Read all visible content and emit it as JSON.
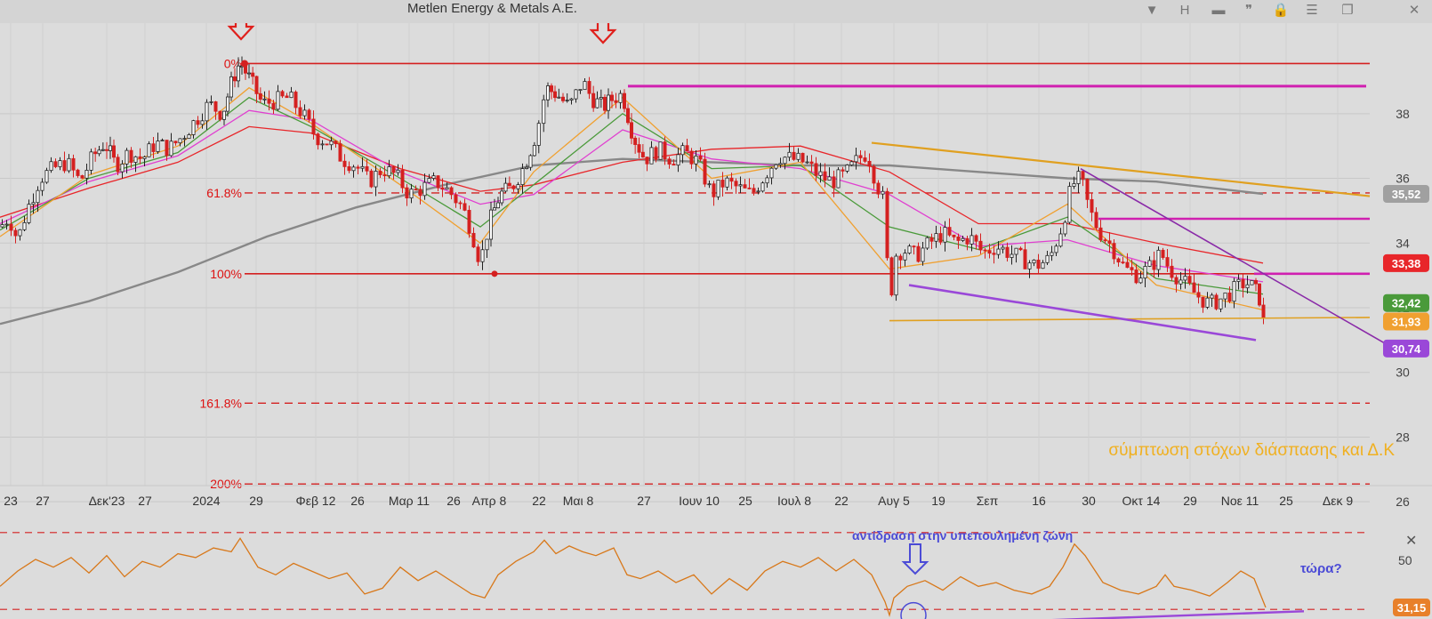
{
  "app": {
    "title": "Metlen Energy & Metals A.E.",
    "toolbar": [
      {
        "name": "dropdown-icon",
        "glyph": "▼"
      },
      {
        "name": "interval-button",
        "glyph": "H"
      },
      {
        "name": "layout-icon",
        "glyph": "▬"
      },
      {
        "name": "comment-icon",
        "glyph": "❞"
      },
      {
        "name": "lock-icon",
        "glyph": "🔒"
      },
      {
        "name": "menu-icon",
        "glyph": "☰"
      },
      {
        "name": "window-icon",
        "glyph": "❐"
      },
      {
        "name": "close-icon",
        "glyph": "✕"
      }
    ]
  },
  "chart_data": [
    {
      "type": "candlestick",
      "title": "Metlen Energy & Metals A.E.",
      "interval": "H",
      "ylim": [
        25.4,
        40.8
      ],
      "yticks": [
        26,
        28,
        30,
        32,
        34,
        36,
        38
      ],
      "xticks": [
        "23",
        "27",
        "Δεκ'23",
        "27",
        "2024",
        "29",
        "Φεβ 12",
        "26",
        "Μαρ 11",
        "26",
        "Απρ 8",
        "22",
        "Μαι 8",
        "27",
        "Ιουν 10",
        "25",
        "Ιουλ 8",
        "22",
        "Αυγ 5",
        "19",
        "Σεπ",
        "16",
        "30",
        "Οκτ 14",
        "29",
        "Νοε 11",
        "25",
        "Δεκ 9"
      ],
      "close_path": [
        [
          0,
          34.5
        ],
        [
          10,
          34.8
        ],
        [
          20,
          34.1
        ],
        [
          30,
          35.0
        ],
        [
          45,
          36.0
        ],
        [
          60,
          36.3
        ],
        [
          75,
          36.5
        ],
        [
          90,
          35.9
        ],
        [
          105,
          36.7
        ],
        [
          118,
          37.1
        ],
        [
          130,
          36.4
        ],
        [
          145,
          36.8
        ],
        [
          160,
          36.6
        ],
        [
          175,
          37.1
        ],
        [
          190,
          36.9
        ],
        [
          205,
          37.3
        ],
        [
          220,
          37.8
        ],
        [
          235,
          38.3
        ],
        [
          250,
          38.0
        ],
        [
          262,
          39.1
        ],
        [
          270,
          39.6
        ],
        [
          282,
          39.0
        ],
        [
          295,
          38.3
        ],
        [
          310,
          38.4
        ],
        [
          325,
          38.5
        ],
        [
          340,
          38.0
        ],
        [
          355,
          37.3
        ],
        [
          370,
          37.1
        ],
        [
          385,
          36.6
        ],
        [
          400,
          36.4
        ],
        [
          415,
          35.9
        ],
        [
          430,
          36.3
        ],
        [
          445,
          36.1
        ],
        [
          460,
          35.5
        ],
        [
          475,
          35.7
        ],
        [
          490,
          35.9
        ],
        [
          505,
          35.6
        ],
        [
          520,
          35.1
        ],
        [
          530,
          34.4
        ],
        [
          540,
          33.4
        ],
        [
          550,
          34.6
        ],
        [
          562,
          35.5
        ],
        [
          575,
          35.7
        ],
        [
          590,
          36.4
        ],
        [
          603,
          37.4
        ],
        [
          614,
          38.8
        ],
        [
          626,
          38.6
        ],
        [
          640,
          38.2
        ],
        [
          655,
          39.0
        ],
        [
          665,
          38.5
        ],
        [
          678,
          38.2
        ],
        [
          690,
          38.5
        ],
        [
          700,
          38.6
        ],
        [
          712,
          37.3
        ],
        [
          725,
          36.6
        ],
        [
          740,
          36.9
        ],
        [
          755,
          36.6
        ],
        [
          770,
          36.8
        ],
        [
          785,
          36.5
        ],
        [
          800,
          35.5
        ],
        [
          815,
          35.9
        ],
        [
          830,
          35.7
        ],
        [
          845,
          35.5
        ],
        [
          860,
          36.1
        ],
        [
          875,
          36.7
        ],
        [
          890,
          36.6
        ],
        [
          905,
          36.5
        ],
        [
          920,
          36.1
        ],
        [
          935,
          35.9
        ],
        [
          950,
          36.1
        ],
        [
          965,
          36.6
        ],
        [
          975,
          36.8
        ],
        [
          985,
          35.9
        ],
        [
          995,
          35.2
        ],
        [
          1000,
          31.6
        ],
        [
          1005,
          33.6
        ],
        [
          1015,
          33.8
        ],
        [
          1030,
          33.6
        ],
        [
          1045,
          34.0
        ],
        [
          1060,
          34.3
        ],
        [
          1075,
          34.0
        ],
        [
          1090,
          34.2
        ],
        [
          1105,
          33.7
        ],
        [
          1120,
          33.9
        ],
        [
          1135,
          33.7
        ],
        [
          1150,
          33.5
        ],
        [
          1165,
          33.3
        ],
        [
          1180,
          33.5
        ],
        [
          1195,
          34.6
        ],
        [
          1205,
          35.8
        ],
        [
          1215,
          36.0
        ],
        [
          1225,
          35.0
        ],
        [
          1235,
          34.4
        ],
        [
          1250,
          33.9
        ],
        [
          1265,
          33.2
        ],
        [
          1280,
          33.0
        ],
        [
          1295,
          33.3
        ],
        [
          1305,
          33.7
        ],
        [
          1315,
          33.2
        ],
        [
          1330,
          32.8
        ],
        [
          1345,
          32.4
        ],
        [
          1360,
          32.1
        ],
        [
          1375,
          32.3
        ],
        [
          1390,
          32.6
        ],
        [
          1400,
          32.8
        ],
        [
          1410,
          32.6
        ],
        [
          1418,
          32.2
        ],
        [
          1423,
          30.9
        ]
      ],
      "series": [
        {
          "name": "",
          "color": "#888888",
          "values": [
            [
              0,
              31.5
            ],
            [
              100,
              32.2
            ],
            [
              200,
              33.1
            ],
            [
              300,
              34.2
            ],
            [
              400,
              35.1
            ],
            [
              500,
              35.8
            ],
            [
              600,
              36.4
            ],
            [
              700,
              36.6
            ],
            [
              800,
              36.5
            ],
            [
              900,
              36.4
            ],
            [
              1000,
              36.4
            ],
            [
              1100,
              36.2
            ],
            [
              1200,
              36.0
            ],
            [
              1300,
              35.9
            ],
            [
              1420,
              35.52
            ]
          ]
        },
        {
          "name": "",
          "color": "#e8262a",
          "values": [
            [
              0,
              34.8
            ],
            [
              100,
              35.7
            ],
            [
              200,
              36.5
            ],
            [
              280,
              37.6
            ],
            [
              350,
              37.4
            ],
            [
              450,
              36.3
            ],
            [
              540,
              35.6
            ],
            [
              600,
              35.8
            ],
            [
              700,
              36.5
            ],
            [
              800,
              36.9
            ],
            [
              900,
              37.0
            ],
            [
              1000,
              36.2
            ],
            [
              1100,
              34.6
            ],
            [
              1200,
              34.6
            ],
            [
              1300,
              34.0
            ],
            [
              1420,
              33.38
            ]
          ]
        },
        {
          "name": "",
          "color": "#e040d0",
          "values": [
            [
              0,
              34.6
            ],
            [
              100,
              35.9
            ],
            [
              200,
              36.7
            ],
            [
              280,
              38.1
            ],
            [
              350,
              37.8
            ],
            [
              450,
              36.2
            ],
            [
              540,
              35.2
            ],
            [
              600,
              35.5
            ],
            [
              700,
              37.5
            ],
            [
              800,
              36.6
            ],
            [
              900,
              36.3
            ],
            [
              1000,
              35.5
            ],
            [
              1100,
              33.9
            ],
            [
              1200,
              34.1
            ],
            [
              1300,
              33.3
            ],
            [
              1420,
              32.8
            ]
          ]
        },
        {
          "name": "",
          "color": "#4a9a3a",
          "values": [
            [
              0,
              34.4
            ],
            [
              100,
              36.0
            ],
            [
              200,
              36.8
            ],
            [
              280,
              38.5
            ],
            [
              350,
              37.6
            ],
            [
              450,
              36.0
            ],
            [
              540,
              34.5
            ],
            [
              600,
              35.8
            ],
            [
              700,
              38.0
            ],
            [
              800,
              36.3
            ],
            [
              900,
              36.4
            ],
            [
              1000,
              34.5
            ],
            [
              1100,
              33.8
            ],
            [
              1200,
              34.8
            ],
            [
              1300,
              32.9
            ],
            [
              1420,
              32.42
            ]
          ]
        },
        {
          "name": "",
          "color": "#f0a030",
          "values": [
            [
              0,
              34.2
            ],
            [
              100,
              36.1
            ],
            [
              200,
              37.0
            ],
            [
              280,
              38.8
            ],
            [
              350,
              37.7
            ],
            [
              450,
              35.8
            ],
            [
              540,
              34.0
            ],
            [
              600,
              36.2
            ],
            [
              700,
              38.5
            ],
            [
              800,
              36.0
            ],
            [
              900,
              36.5
            ],
            [
              1000,
              33.2
            ],
            [
              1100,
              33.6
            ],
            [
              1200,
              35.2
            ],
            [
              1300,
              32.7
            ],
            [
              1420,
              31.93
            ]
          ]
        }
      ],
      "fibonacci": [
        {
          "label": "0%",
          "value": 39.55
        },
        {
          "label": "61.8%",
          "value": 35.55
        },
        {
          "label": "100%",
          "value": 33.05
        },
        {
          "label": "161.8%",
          "value": 29.05
        },
        {
          "label": "200%",
          "value": 26.55
        }
      ],
      "price_labels": [
        {
          "value": "35,52",
          "color": "#a0a0a0"
        },
        {
          "value": "33,38",
          "color": "#e8262a"
        },
        {
          "value": "32,42",
          "color": "#4a9a3a"
        },
        {
          "value": "31,93",
          "color": "#f0a030"
        },
        {
          "value": "30,74",
          "color": "#9a48d8"
        }
      ],
      "annotation": "σύμπτωση στόχων διάσπασης και Δ.Κ"
    },
    {
      "type": "line",
      "title": "",
      "ylim": [
        25,
        75
      ],
      "yticks": [
        50
      ],
      "current_value": "31,15",
      "values": [
        [
          0,
          42
        ],
        [
          20,
          50
        ],
        [
          40,
          56
        ],
        [
          60,
          52
        ],
        [
          80,
          57
        ],
        [
          100,
          49
        ],
        [
          120,
          58
        ],
        [
          140,
          47
        ],
        [
          160,
          55
        ],
        [
          180,
          52
        ],
        [
          200,
          59
        ],
        [
          220,
          57
        ],
        [
          240,
          62
        ],
        [
          260,
          60
        ],
        [
          270,
          67
        ],
        [
          290,
          52
        ],
        [
          310,
          48
        ],
        [
          330,
          54
        ],
        [
          350,
          50
        ],
        [
          370,
          46
        ],
        [
          390,
          49
        ],
        [
          410,
          38
        ],
        [
          430,
          41
        ],
        [
          450,
          52
        ],
        [
          470,
          45
        ],
        [
          490,
          50
        ],
        [
          510,
          44
        ],
        [
          530,
          38
        ],
        [
          545,
          36
        ],
        [
          560,
          48
        ],
        [
          580,
          55
        ],
        [
          600,
          60
        ],
        [
          612,
          66
        ],
        [
          625,
          59
        ],
        [
          640,
          63
        ],
        [
          655,
          60
        ],
        [
          670,
          58
        ],
        [
          690,
          62
        ],
        [
          705,
          48
        ],
        [
          720,
          46
        ],
        [
          740,
          50
        ],
        [
          760,
          44
        ],
        [
          780,
          48
        ],
        [
          800,
          38
        ],
        [
          820,
          46
        ],
        [
          840,
          40
        ],
        [
          860,
          50
        ],
        [
          880,
          55
        ],
        [
          900,
          52
        ],
        [
          920,
          57
        ],
        [
          940,
          50
        ],
        [
          960,
          56
        ],
        [
          980,
          48
        ],
        [
          995,
          34
        ],
        [
          1000,
          27
        ],
        [
          1005,
          36
        ],
        [
          1020,
          42
        ],
        [
          1040,
          45
        ],
        [
          1060,
          40
        ],
        [
          1080,
          47
        ],
        [
          1100,
          42
        ],
        [
          1120,
          44
        ],
        [
          1140,
          40
        ],
        [
          1160,
          38
        ],
        [
          1180,
          42
        ],
        [
          1195,
          52
        ],
        [
          1208,
          64
        ],
        [
          1220,
          58
        ],
        [
          1240,
          44
        ],
        [
          1260,
          40
        ],
        [
          1280,
          38
        ],
        [
          1300,
          42
        ],
        [
          1310,
          48
        ],
        [
          1320,
          42
        ],
        [
          1340,
          40
        ],
        [
          1360,
          37
        ],
        [
          1380,
          44
        ],
        [
          1395,
          50
        ],
        [
          1410,
          46
        ],
        [
          1423,
          31
        ]
      ],
      "annotations": {
        "reaction": "αντίδραση στην υπεπουλημένη ζώνη",
        "now": "τώρα?"
      }
    }
  ]
}
